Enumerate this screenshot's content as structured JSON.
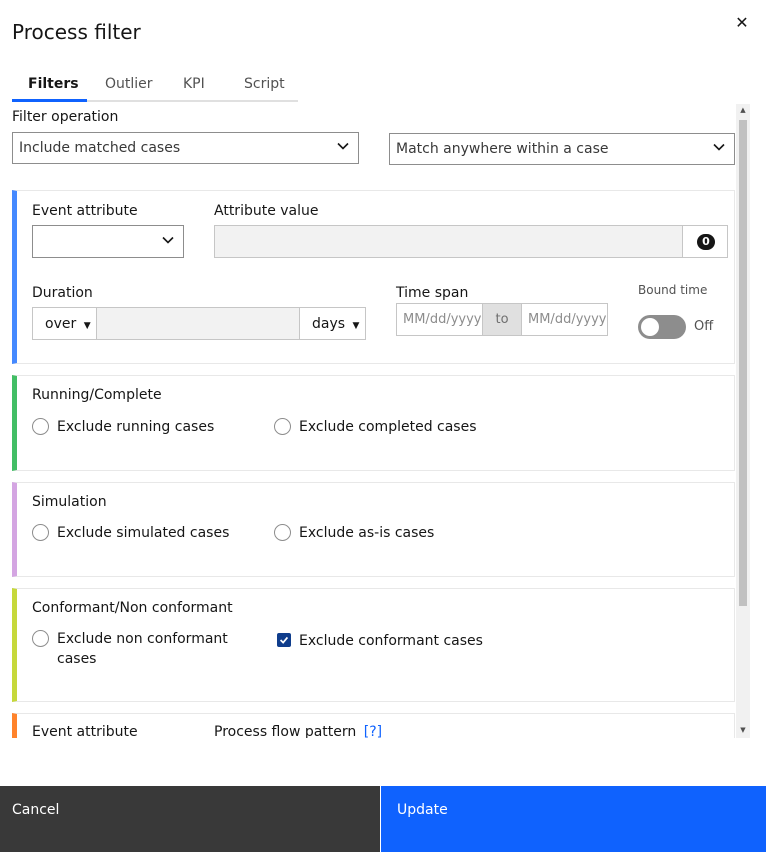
{
  "header": {
    "title": "Process filter",
    "close_icon": "close-icon"
  },
  "tabs": [
    {
      "label": "Filters",
      "active": true
    },
    {
      "label": "Outlier",
      "active": false
    },
    {
      "label": "KPI",
      "active": false
    },
    {
      "label": "Script",
      "active": false
    }
  ],
  "filter_operation": {
    "label": "Filter operation",
    "mode": "Include matched cases",
    "match": "Match anywhere within a case"
  },
  "event_card": {
    "event_attribute_label": "Event attribute",
    "event_attribute_value": "",
    "attribute_value_label": "Attribute value",
    "attribute_value_count": "0",
    "duration_label": "Duration",
    "duration_op": "over",
    "duration_value": "",
    "duration_unit": "days",
    "time_span_label": "Time span",
    "from_placeholder": "MM/dd/yyyy",
    "to_label": "to",
    "to_placeholder": "MM/dd/yyyy",
    "bound_time_label": "Bound time",
    "bound_time_state": "Off",
    "accent": "#4589ff"
  },
  "running_card": {
    "title": "Running/Complete",
    "option1": "Exclude running cases",
    "option2": "Exclude completed cases",
    "accent": "#42be65"
  },
  "simulation_card": {
    "title": "Simulation",
    "option1": "Exclude simulated cases",
    "option2": "Exclude as-is cases",
    "accent": "#d4a5e2"
  },
  "conformant_card": {
    "title": "Conformant/Non conformant",
    "option1": "Exclude non conformant cases",
    "option2": "Exclude conformant cases",
    "option2_checked": true,
    "accent": "#c6d83b"
  },
  "flow_card": {
    "event_attribute_label": "Event attribute",
    "pattern_label": "Process flow pattern",
    "help_link": "[?]",
    "accent": "#ff832b"
  },
  "footer": {
    "cancel": "Cancel",
    "update": "Update"
  }
}
